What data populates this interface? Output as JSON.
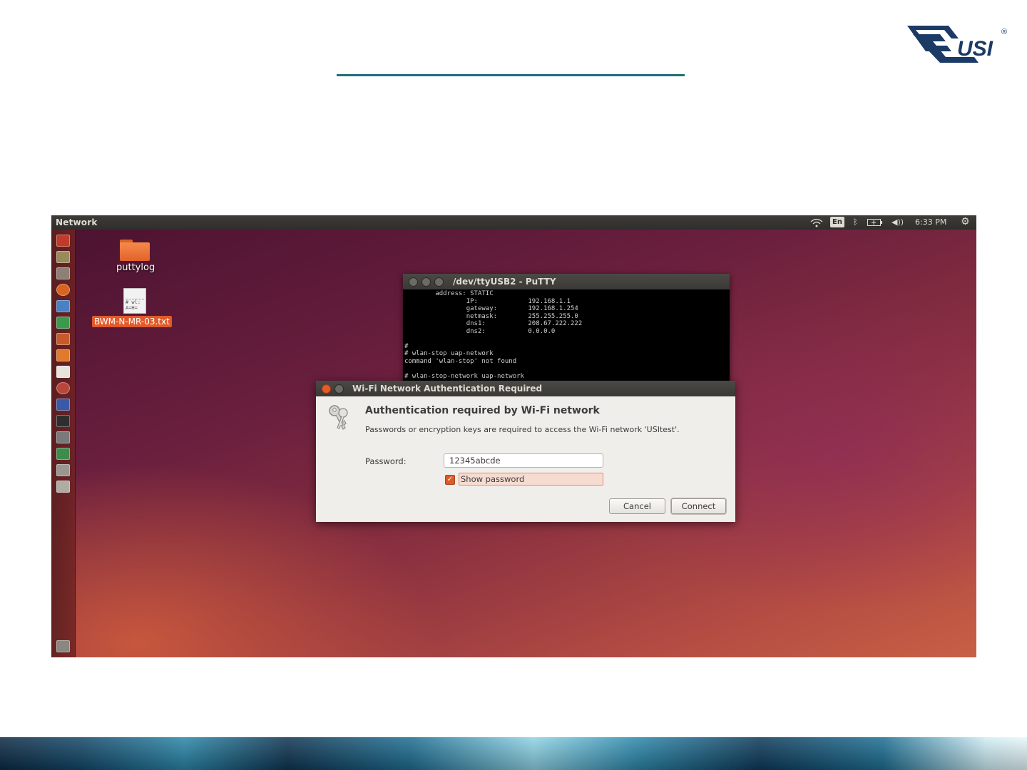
{
  "slide": {
    "logo_text": "USI",
    "logo_mark": "®",
    "accent_color": "#1f6f7a"
  },
  "topbar": {
    "title": "Network",
    "en_label": "En",
    "time": "6:33 PM",
    "indicators": [
      "wifi-icon",
      "keyboard-layout",
      "bluetooth-icon",
      "battery-icon",
      "volume-icon",
      "clock",
      "settings-gear-icon"
    ]
  },
  "launcher": {
    "items": [
      "dash-home-icon",
      "image-viewer-icon",
      "files-icon",
      "firefox-icon",
      "writer-icon",
      "calc-icon",
      "impress-icon",
      "software-center-icon",
      "amazon-icon",
      "system-settings-icon",
      "network-tool-icon",
      "terminal-icon",
      "screenshot-icon",
      "update-manager-icon",
      "wifi-app-icon",
      "disk-icon",
      "trash-icon"
    ]
  },
  "desktop": {
    "folder_label": "puttylog",
    "file_label": "BWM-N-MR-03.txt",
    "file_preview": "# wl: A=H="
  },
  "putty": {
    "title": "/dev/ttyUSB2 - PuTTY",
    "lines": [
      "        address: STATIC",
      "                IP:             192.168.1.1",
      "                gateway:        192.168.1.254",
      "                netmask:        255.255.255.0",
      "                dns1:           208.67.222.222",
      "                dns2:           0.0.0.0",
      "",
      "#",
      "# wlan-stop uap-network",
      "command 'wlan-stop' not found",
      "",
      "# wlan-stop-network uap-network"
    ]
  },
  "dialog": {
    "title": "Wi-Fi Network Authentication Required",
    "heading": "Authentication required by Wi-Fi network",
    "message": "Passwords or encryption keys are required to access the Wi-Fi network 'USItest'.",
    "password_label": "Password:",
    "password_value": "12345abcde",
    "show_password_label": "Show password",
    "show_password_checked": true,
    "cancel_label": "Cancel",
    "connect_label": "Connect"
  }
}
